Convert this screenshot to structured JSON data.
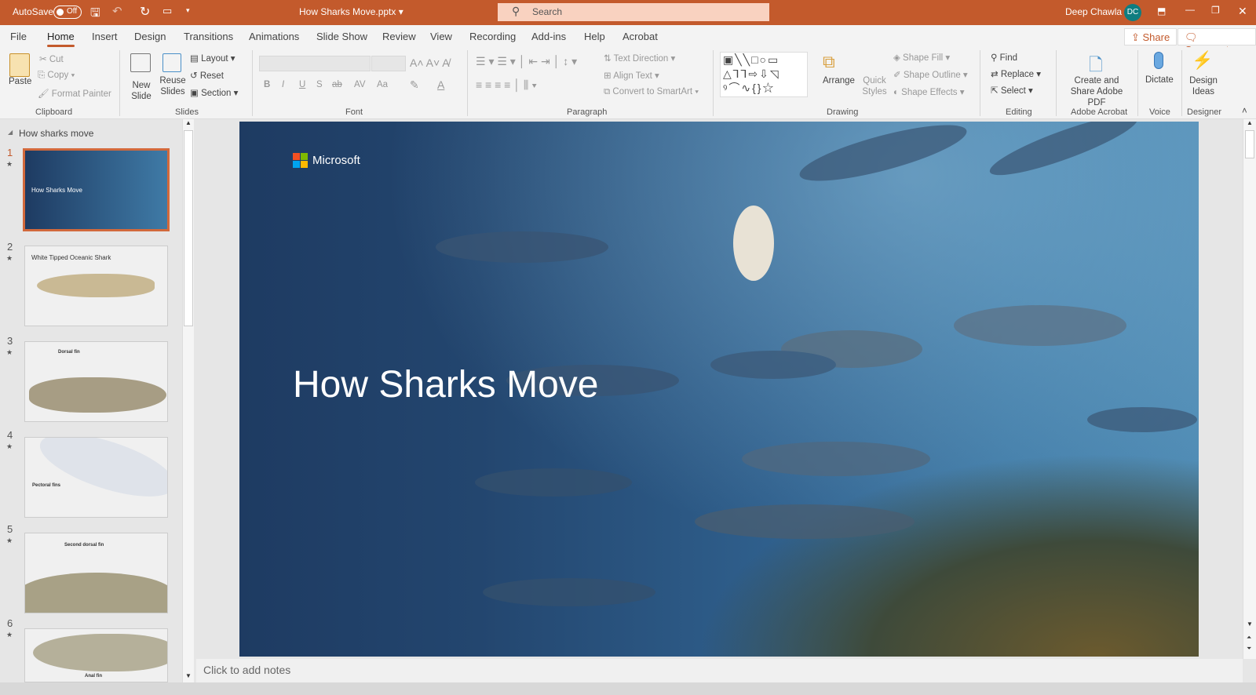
{
  "titlebar": {
    "autosave_label": "AutoSave",
    "autosave_state": "Off",
    "file_name": "How Sharks Move.pptx",
    "search_placeholder": "Search",
    "user_name": "Deep Chawla",
    "user_initials": "DC"
  },
  "tabs": [
    "File",
    "Home",
    "Insert",
    "Design",
    "Transitions",
    "Animations",
    "Slide Show",
    "Review",
    "View",
    "Recording",
    "Add-ins",
    "Help",
    "Acrobat"
  ],
  "active_tab": "Home",
  "share_label": "Share",
  "comments_label": "Comments",
  "ribbon": {
    "clipboard": {
      "label": "Clipboard",
      "paste": "Paste",
      "cut": "Cut",
      "copy": "Copy",
      "format_painter": "Format Painter"
    },
    "slides": {
      "label": "Slides",
      "new_slide": "New Slide",
      "reuse_slides": "Reuse Slides",
      "layout": "Layout",
      "reset": "Reset",
      "section": "Section"
    },
    "font": {
      "label": "Font",
      "bold": "B",
      "italic": "I",
      "underline": "U",
      "strike": "S",
      "spacing": "AV",
      "case": "Aa",
      "color": "A"
    },
    "paragraph": {
      "label": "Paragraph",
      "text_direction": "Text Direction",
      "align_text": "Align Text",
      "convert_smartart": "Convert to SmartArt"
    },
    "drawing": {
      "label": "Drawing",
      "arrange": "Arrange",
      "quick_styles": "Quick Styles",
      "shape_fill": "Shape Fill",
      "shape_outline": "Shape Outline",
      "shape_effects": "Shape Effects"
    },
    "editing": {
      "label": "Editing",
      "find": "Find",
      "replace": "Replace",
      "select": "Select"
    },
    "acrobat": {
      "label": "Adobe Acrobat",
      "create_share": "Create and Share Adobe PDF"
    },
    "voice": {
      "label": "Voice",
      "dictate": "Dictate"
    },
    "designer": {
      "label": "Designer",
      "design_ideas": "Design Ideas"
    }
  },
  "panel": {
    "section": "How sharks move",
    "slides": [
      {
        "num": "1",
        "title": "How Sharks Move"
      },
      {
        "num": "2",
        "title": "White Tipped Oceanic Shark"
      },
      {
        "num": "3",
        "title": "Dorsal fin"
      },
      {
        "num": "4",
        "title": "Pectoral fins"
      },
      {
        "num": "5",
        "title": "Second dorsal fin"
      },
      {
        "num": "6",
        "title": "Anal fin"
      }
    ]
  },
  "slide": {
    "logo": "Microsoft",
    "title": "How Sharks Move"
  },
  "notes_placeholder": "Click to add notes",
  "colors": {
    "accent": "#c35a2c",
    "slide_bg": "#23466f"
  }
}
